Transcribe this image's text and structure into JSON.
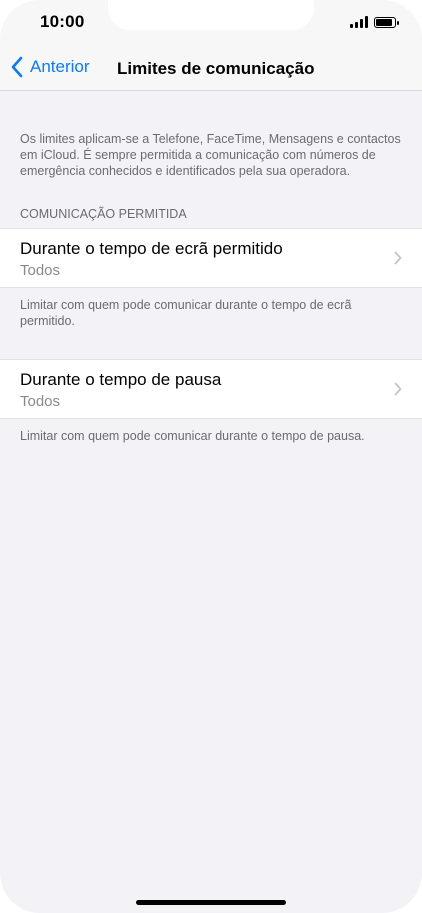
{
  "status": {
    "time": "10:00"
  },
  "nav": {
    "back_label": "Anterior",
    "title": "Limites de comunicação"
  },
  "intro": "Os limites aplicam-se a Telefone, FaceTime, Mensagens e contactos em iCloud. É sempre permitida a comunicação com números de emergência conhecidos e identificados pela sua operadora.",
  "section_header": "COMUNICAÇÃO PERMITIDA",
  "rows": [
    {
      "title": "Durante o tempo de ecrã permitido",
      "value": "Todos",
      "footer": "Limitar com quem pode comunicar durante o tempo de ecrã permitido."
    },
    {
      "title": "Durante o tempo de pausa",
      "value": "Todos",
      "footer": "Limitar com quem pode comunicar durante o tempo de pausa."
    }
  ],
  "colors": {
    "accent": "#0a7aff",
    "background": "#f2f2f7"
  }
}
